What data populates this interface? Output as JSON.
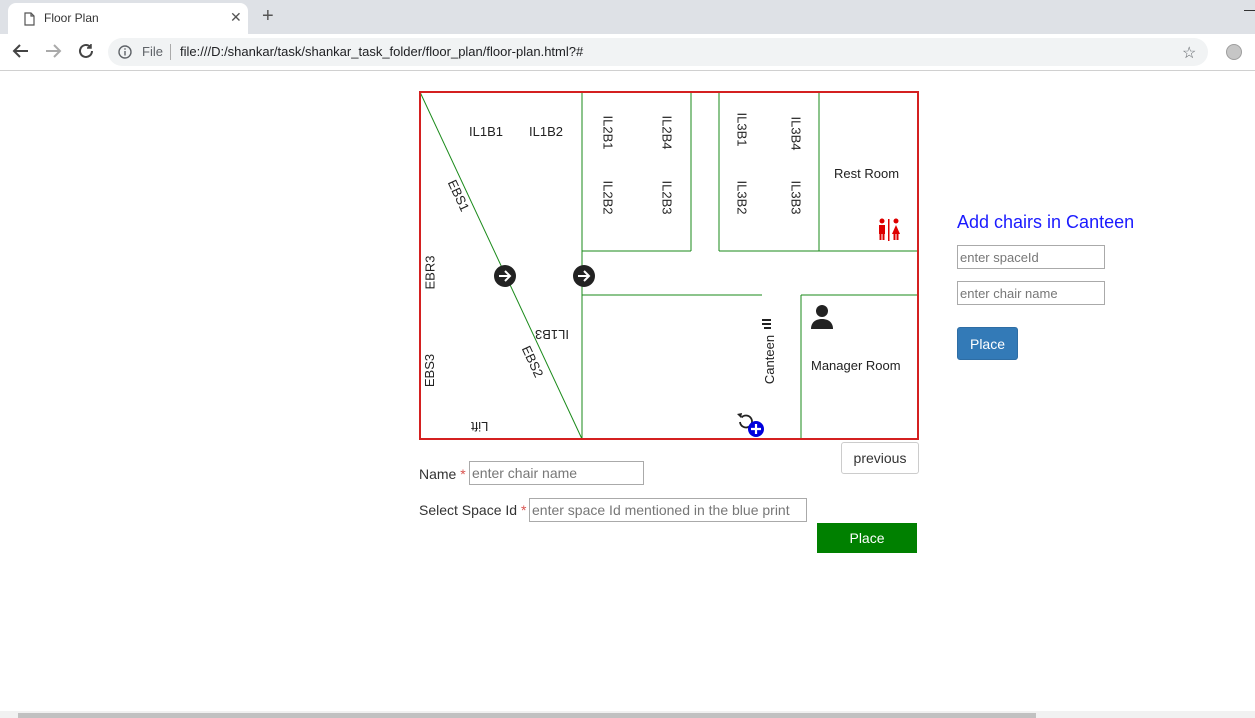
{
  "browser": {
    "tab_title": "Floor Plan",
    "new_tab_symbol": "+",
    "close_symbol": "✕",
    "file_label": "File",
    "url": "file:///D:/shankar/task/shankar_task_folder/floor_plan/floor-plan.html?#"
  },
  "plan": {
    "labels": {
      "il1b1": "IL1B1",
      "il1b2": "IL1B2",
      "il2b1": "IL2B1",
      "il2b4": "IL2B4",
      "il2b2": "IL2B2",
      "il2b3": "IL2B3",
      "il3b1": "IL3B1",
      "il3b4": "IL3B4",
      "il3b2": "IL3B2",
      "il3b3": "IL3B3",
      "rest_room": "Rest Room",
      "ebs1": "EBS1",
      "ebr3": "EBR3",
      "ebs3": "EBS3",
      "ebs2": "EBS2",
      "il1b3": "IL1B3",
      "lift": "Lift",
      "canteen": "Canteen",
      "manager_room": "Manager Room"
    },
    "colors": {
      "border": "#d42020",
      "walls": "#1a8a1a",
      "restroom_icon": "#dd0000",
      "plus_icon": "#0000dd"
    }
  },
  "side": {
    "title": "Add chairs in Canteen",
    "space_placeholder": "enter spaceId",
    "chair_placeholder": "enter chair name",
    "place_label": "Place"
  },
  "form": {
    "previous_label": "previous",
    "name_label": "Name",
    "required_mark": "*",
    "name_placeholder": "enter chair name",
    "space_label": "Select Space Id",
    "space_placeholder": "enter space Id mentioned in the blue print",
    "place_label": "Place"
  }
}
